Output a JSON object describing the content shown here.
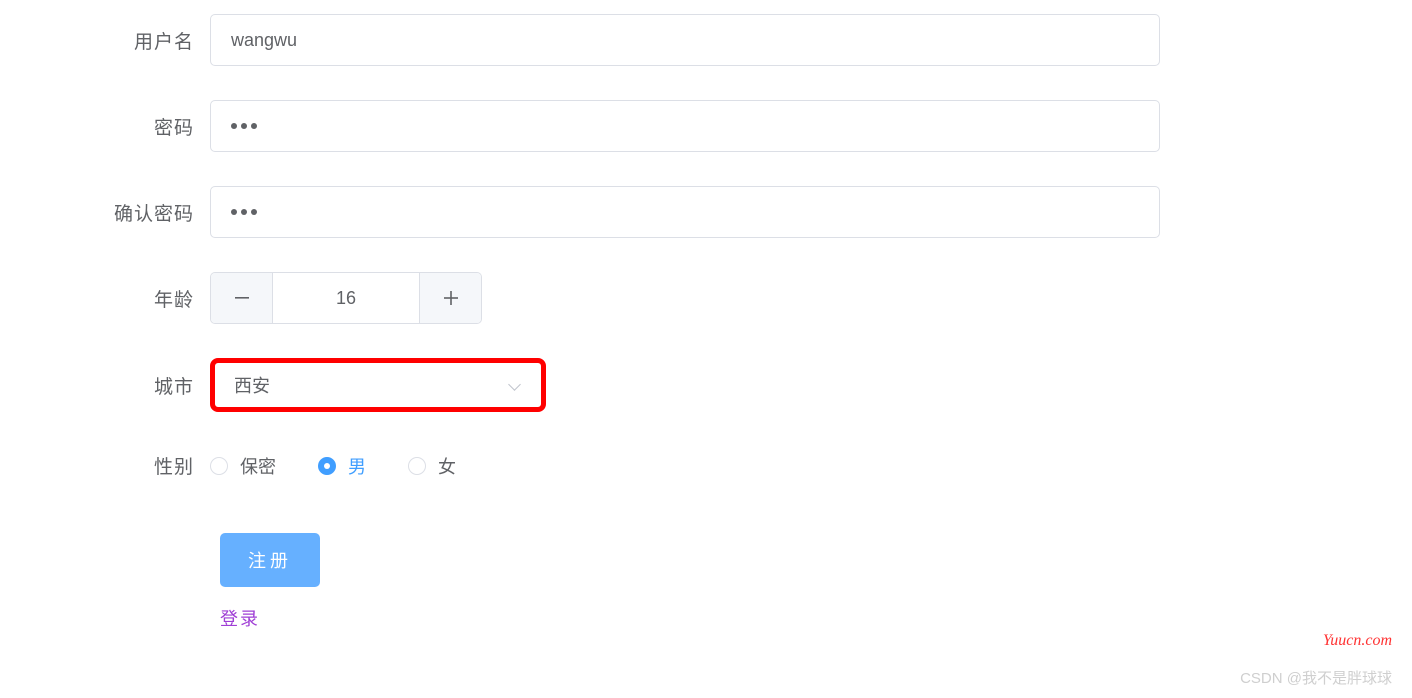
{
  "form": {
    "username": {
      "label": "用户名",
      "value": "wangwu"
    },
    "password": {
      "label": "密码",
      "value": "•••"
    },
    "confirm_password": {
      "label": "确认密码",
      "value": "•••"
    },
    "age": {
      "label": "年龄",
      "value": "16",
      "minus": "−",
      "plus": "+"
    },
    "city": {
      "label": "城市",
      "value": "西安"
    },
    "gender": {
      "label": "性别",
      "options": [
        {
          "label": "保密",
          "checked": false
        },
        {
          "label": "男",
          "checked": true
        },
        {
          "label": "女",
          "checked": false
        }
      ]
    },
    "submit": {
      "label": "注册"
    },
    "login_link": {
      "label": "登录"
    }
  },
  "watermark": {
    "right": "Yuucn.com",
    "bottom": "CSDN @我不是胖球球"
  }
}
